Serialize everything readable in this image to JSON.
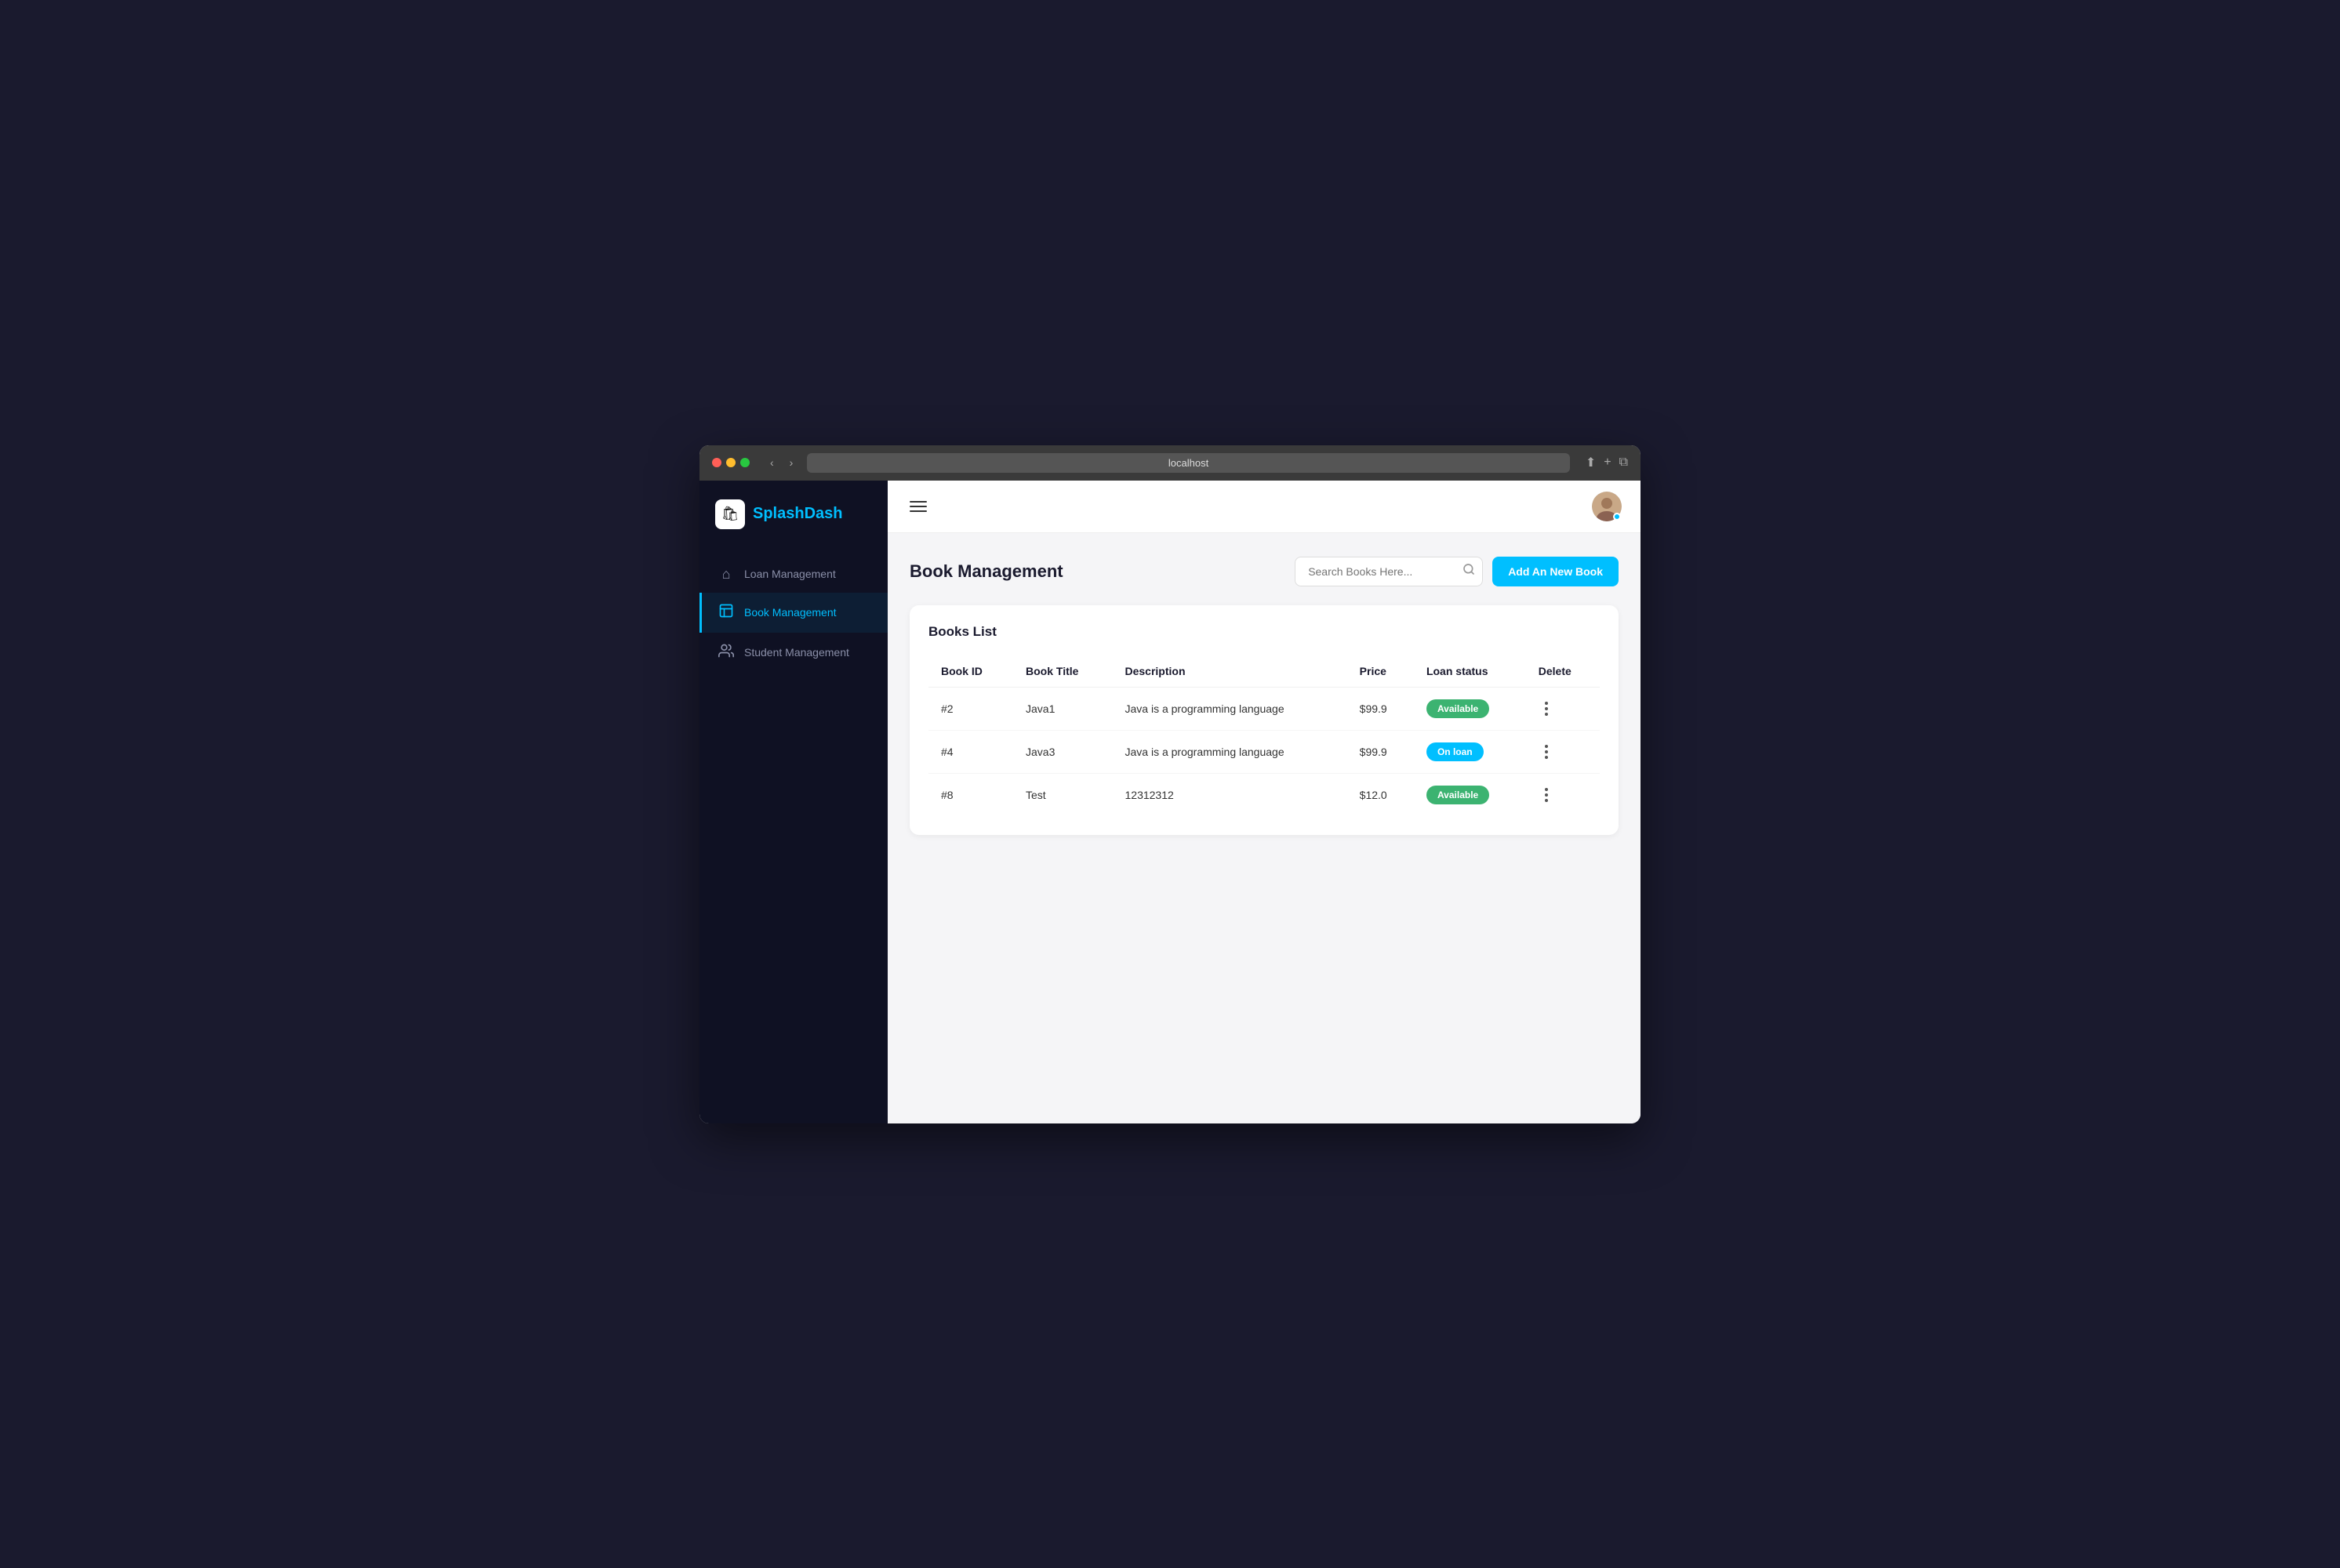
{
  "browser": {
    "url": "localhost",
    "reload_icon": "↻"
  },
  "sidebar": {
    "logo_icon": "🛍",
    "logo_splash": "Splash",
    "logo_dash": "Dash",
    "nav_items": [
      {
        "id": "loan-management",
        "label": "Loan Management",
        "icon": "⌂",
        "active": false
      },
      {
        "id": "book-management",
        "label": "Book Management",
        "icon": "📦",
        "active": true
      },
      {
        "id": "student-management",
        "label": "Student Management",
        "icon": "👥",
        "active": false
      }
    ]
  },
  "topbar": {
    "hamburger_label": "menu",
    "avatar_emoji": "👤"
  },
  "page": {
    "title": "Book Management",
    "search_placeholder": "Search Books Here...",
    "add_button_label": "Add An New Book",
    "books_list_title": "Books List",
    "table": {
      "columns": [
        "Book ID",
        "Book Title",
        "Description",
        "Price",
        "Loan status",
        "Delete"
      ],
      "rows": [
        {
          "id": "#2",
          "title": "Java1",
          "description": "Java is a programming language",
          "price": "$99.9",
          "status": "Available",
          "status_type": "available"
        },
        {
          "id": "#4",
          "title": "Java3",
          "description": "Java is a programming language",
          "price": "$99.9",
          "status": "On loan",
          "status_type": "on-loan"
        },
        {
          "id": "#8",
          "title": "Test",
          "description": "12312312",
          "price": "$12.0",
          "status": "Available",
          "status_type": "available"
        }
      ]
    }
  }
}
